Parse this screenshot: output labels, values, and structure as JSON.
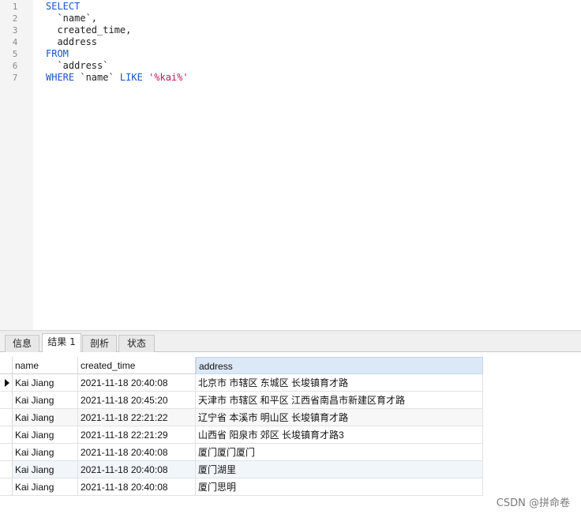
{
  "editor": {
    "lines": [
      {
        "num": "1",
        "tokens": [
          {
            "t": "SELECT",
            "k": "kw"
          }
        ]
      },
      {
        "num": "2",
        "tokens": [
          {
            "t": "  `name`,",
            "k": "id"
          }
        ]
      },
      {
        "num": "3",
        "tokens": [
          {
            "t": "  created_time,",
            "k": "id"
          }
        ]
      },
      {
        "num": "4",
        "tokens": [
          {
            "t": "  address",
            "k": "id"
          }
        ]
      },
      {
        "num": "5",
        "tokens": [
          {
            "t": "FROM",
            "k": "kw"
          }
        ]
      },
      {
        "num": "6",
        "tokens": [
          {
            "t": "  `address`",
            "k": "id"
          }
        ]
      },
      {
        "num": "7",
        "tokens": [
          {
            "t": "WHERE",
            "k": "kw"
          },
          {
            "t": " `name` ",
            "k": "id"
          },
          {
            "t": "LIKE",
            "k": "kw"
          },
          {
            "t": " ",
            "k": "id"
          },
          {
            "t": "'%kai%'",
            "k": "str"
          }
        ]
      }
    ]
  },
  "tabs": {
    "info": "信息",
    "result1": "结果 1",
    "profile": "剖析",
    "status": "状态"
  },
  "grid": {
    "columns": [
      "name",
      "created_time",
      "address"
    ],
    "rows": [
      [
        "Kai Jiang",
        "2021-11-18 20:40:08",
        "北京市 市辖区 东城区 长埈镇育才路"
      ],
      [
        "Kai Jiang",
        "2021-11-18 20:45:20",
        "天津市 市辖区 和平区 江西省南昌市新建区育才路"
      ],
      [
        "Kai Jiang",
        "2021-11-18 22:21:22",
        "辽宁省 本溪市 明山区 长埈镇育才路"
      ],
      [
        "Kai Jiang",
        "2021-11-18 22:21:29",
        "山西省 阳泉市 郊区 长埈镇育才路3"
      ],
      [
        "Kai Jiang",
        "2021-11-18 20:40:08",
        "厦门厦门厦门"
      ],
      [
        "Kai Jiang",
        "2021-11-18 20:40:08",
        "厦门湖里"
      ],
      [
        "Kai Jiang",
        "2021-11-18 20:40:08",
        "厦门思明"
      ]
    ]
  },
  "watermark": "CSDN @拼命卷"
}
